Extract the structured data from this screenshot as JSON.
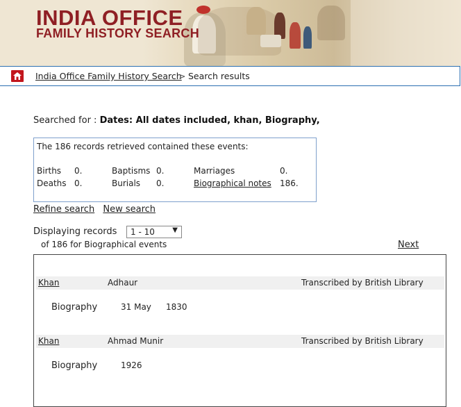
{
  "header": {
    "title_line1": "INDIA OFFICE",
    "title_line2": "FAMILY HISTORY SEARCH"
  },
  "breadcrumb": {
    "home_icon": "home-icon",
    "link": "India Office Family History Search",
    "separator": ">",
    "current": "Search results"
  },
  "search": {
    "label": "Searched for :",
    "terms": "Dates: All dates included, khan, Biography,"
  },
  "events": {
    "intro": "The 186 records retrieved contained these events:",
    "births_label": "Births",
    "births_value": "0.",
    "deaths_label": "Deaths",
    "deaths_value": "0.",
    "baptisms_label": "Baptisms",
    "baptisms_value": "0.",
    "burials_label": "Burials",
    "burials_value": "0.",
    "marriages_label": "Marriages",
    "marriages_value": "0.",
    "bio_label": "Biographical notes",
    "bio_value": "186."
  },
  "actions": {
    "refine": "Refine search",
    "new": "New search"
  },
  "pagination": {
    "label": "Displaying records",
    "selected": "1 - 10",
    "of_text": "of 186 for Biographical events",
    "next": "Next"
  },
  "results": [
    {
      "surname": "Khan",
      "given": "Adhaur",
      "source": "Transcribed by British Library",
      "event_type": "Biography",
      "date1": "31 May",
      "date2": "1830"
    },
    {
      "surname": "Khan",
      "given": "Ahmad Munir",
      "source": "Transcribed by British Library",
      "event_type": "Biography",
      "date1": "1926",
      "date2": ""
    }
  ],
  "colors": {
    "brand": "#8f1f24",
    "home_icon_bg": "#c2161d",
    "border_blue": "#2b6fb1"
  }
}
